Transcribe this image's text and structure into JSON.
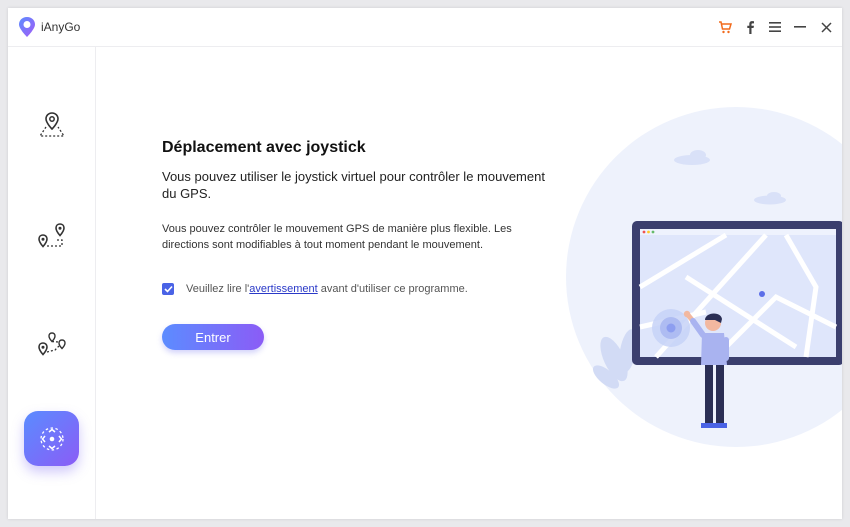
{
  "app": {
    "name": "iAnyGo",
    "icons": {
      "logo": "ianygo-logo",
      "cart": "cart-icon",
      "facebook": "facebook-icon",
      "menu": "menu-icon",
      "minimize": "minimize-icon",
      "close": "close-icon"
    }
  },
  "sidebar": {
    "items": [
      {
        "name": "teleport-mode",
        "icon": "single-pin-icon"
      },
      {
        "name": "two-spot-mode",
        "icon": "two-pins-icon"
      },
      {
        "name": "multi-spot-mode",
        "icon": "multi-pins-icon"
      },
      {
        "name": "joystick-mode",
        "icon": "joystick-icon",
        "active": true
      }
    ]
  },
  "main": {
    "title": "Déplacement avec joystick",
    "lead": "Vous pouvez utiliser le joystick virtuel pour contrôler le mouvement du GPS.",
    "body": "Vous pouvez contrôler le mouvement GPS de manière plus flexible. Les directions sont modifiables à tout moment pendant le mouvement.",
    "agreement": {
      "checked": true,
      "prefix": "Veuillez lire l'",
      "link": "avertissement",
      "suffix": " avant d'utiliser ce programme."
    },
    "enter_label": "Entrer"
  },
  "colors": {
    "accent": "#4a63e6",
    "gradient_start": "#5c8cff",
    "gradient_end": "#8b5cf6",
    "cart": "#f26b1d",
    "tablet_frame": "#3b3f6e"
  }
}
